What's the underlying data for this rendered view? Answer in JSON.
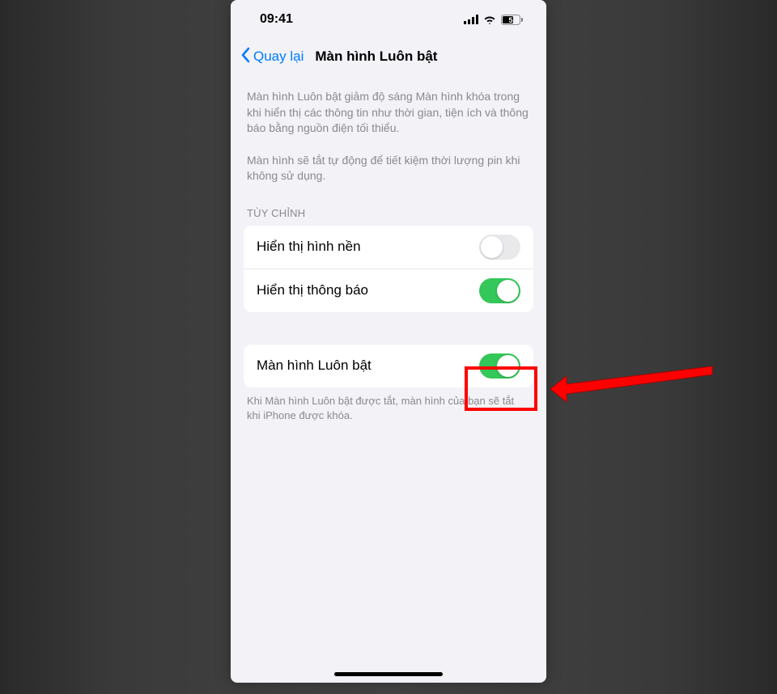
{
  "status": {
    "time": "09:41",
    "battery": "5"
  },
  "nav": {
    "back_label": "Quay lại",
    "title": "Màn hình Luôn bật"
  },
  "descriptions": {
    "para1": "Màn hình Luôn bật giảm độ sáng Màn hình khóa trong khi hiển thị các thông tin như thời gian, tiện ích và thông báo bằng nguồn điện tối thiểu.",
    "para2": "Màn hình sẽ tắt tự động để tiết kiệm thời lượng pin khi không sử dụng."
  },
  "section": {
    "header": "TÙY CHỈNH",
    "rows": [
      {
        "label": "Hiển thị hình nền",
        "on": false
      },
      {
        "label": "Hiển thị thông báo",
        "on": true
      }
    ]
  },
  "main_toggle": {
    "label": "Màn hình Luôn bật",
    "on": true
  },
  "footer": "Khi Màn hình Luôn bật được tắt, màn hình của bạn sẽ tắt khi iPhone được khóa."
}
